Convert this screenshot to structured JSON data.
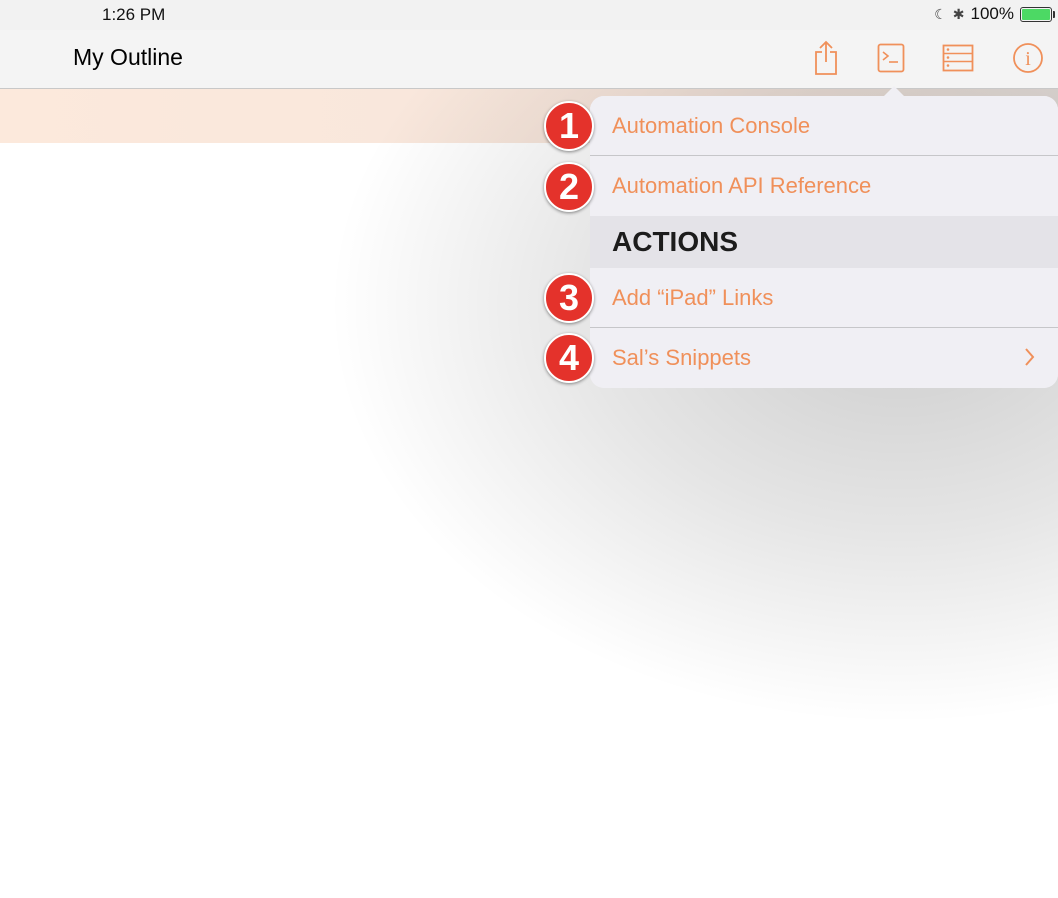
{
  "status_bar": {
    "time": "1:26 PM",
    "battery_text": "100%",
    "icons": [
      "moon-icon",
      "bluetooth-icon",
      "battery-icon"
    ]
  },
  "nav": {
    "title": "My Outline",
    "buttons": [
      "share-icon",
      "console-icon",
      "layout-icon",
      "info-icon"
    ]
  },
  "popover": {
    "items": [
      {
        "badge": "1",
        "label": "Automation Console"
      },
      {
        "badge": "2",
        "label": "Automation API Reference"
      }
    ],
    "section_header": "ACTIONS",
    "actions": [
      {
        "badge": "3",
        "label": "Add “iPad” Links"
      },
      {
        "badge": "4",
        "label": "Sal’s Snippets",
        "has_chevron": true
      }
    ]
  },
  "colors": {
    "accent": "#f0905a",
    "badge_red": "#e4322b",
    "battery_green": "#4cd964",
    "selected_row": "#fce9dc"
  }
}
